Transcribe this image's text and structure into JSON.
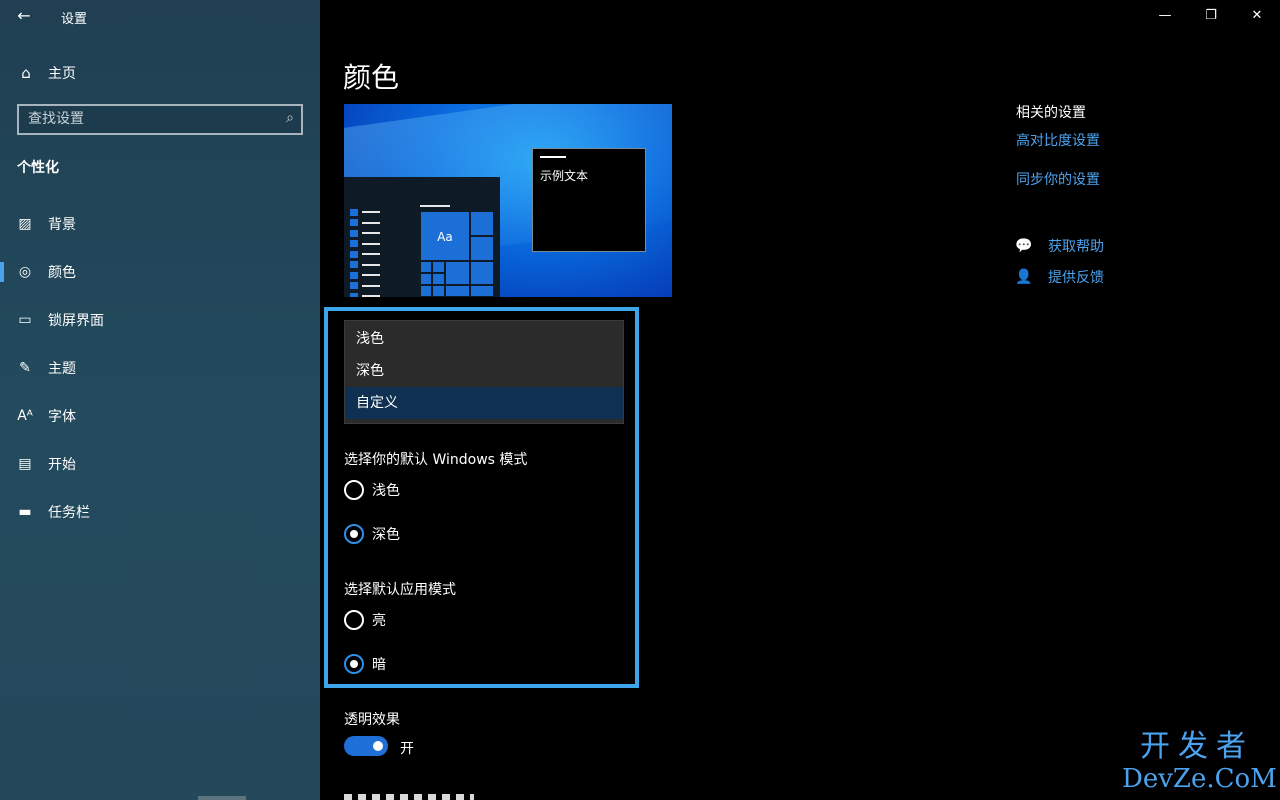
{
  "window": {
    "app_title": "设置",
    "back_icon": "←",
    "minimize_icon": "—",
    "restore_icon": "❐",
    "close_icon": "✕"
  },
  "sidebar": {
    "home_label": "主页",
    "home_icon": "⌂",
    "search_placeholder": "查找设置",
    "search_icon": "⌕",
    "section_title": "个性化",
    "items": [
      {
        "label": "背景",
        "icon": "▨"
      },
      {
        "label": "颜色",
        "icon": "◎"
      },
      {
        "label": "锁屏界面",
        "icon": "▭"
      },
      {
        "label": "主题",
        "icon": "✎"
      },
      {
        "label": "字体",
        "icon": "Aᴬ"
      },
      {
        "label": "开始",
        "icon": "▤"
      },
      {
        "label": "任务栏",
        "icon": "▬"
      }
    ],
    "active_index": 1
  },
  "main": {
    "page_title": "颜色",
    "preview": {
      "tile_text": "Aa",
      "sample_text": "示例文本"
    },
    "dropdown": {
      "options": [
        "浅色",
        "深色",
        "自定义"
      ],
      "selected": "自定义"
    },
    "windows_mode": {
      "label": "选择你的默认 Windows 模式",
      "options": [
        "浅色",
        "深色"
      ],
      "selected": "深色"
    },
    "app_mode": {
      "label": "选择默认应用模式",
      "options": [
        "亮",
        "暗"
      ],
      "selected": "暗"
    },
    "transparency": {
      "label": "透明效果",
      "state_label": "开",
      "on": true
    }
  },
  "related": {
    "title": "相关的设置",
    "links": [
      "高对比度设置",
      "同步你的设置"
    ],
    "help": [
      {
        "label": "获取帮助",
        "icon": "💬"
      },
      {
        "label": "提供反馈",
        "icon": "👤"
      }
    ]
  },
  "watermark": {
    "line1": "开发者",
    "line2": "DevZe.CoM"
  },
  "colors": {
    "accent": "#1e70d8",
    "link": "#4ba3ef",
    "highlight_frame": "#3da6ea",
    "sidebar_bg": "#234a5d"
  }
}
